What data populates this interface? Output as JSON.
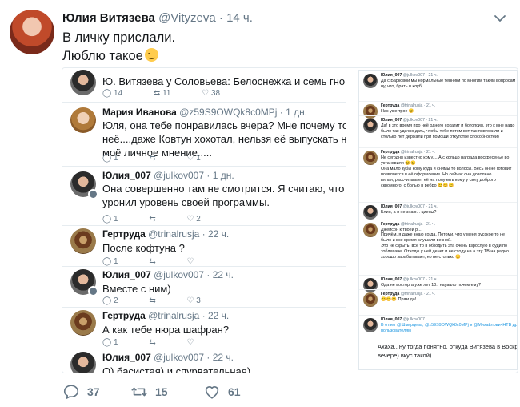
{
  "tweet": {
    "author_name": "Юлия Витязева",
    "author_handle": "@Vityzeva",
    "dot": "·",
    "time": "14 ч.",
    "lines": [
      "В личку прислали.",
      "Люблю такое"
    ],
    "emoji": "wink-smile-emoji"
  },
  "left_thread": [
    {
      "kind": "top",
      "body": "Ю. Витязева у Соловьева: Белоснежка и семь гномов)",
      "replies": "14",
      "retweets": "11",
      "likes": "38"
    },
    {
      "kind": "reply",
      "name": "Мария Иванова",
      "handle": "@z59S9OWQk8c0MPj",
      "time": "· 1 дн.",
      "lines": [
        "Юля, она тебе понравилась вчера? Мне почему то было неловко за",
        "неё....даже Ковтун хохотал, нельзя её выпускать на экран...., но это",
        "моё личное мнение....."
      ],
      "replies": "1",
      "retweets": "",
      "likes": "1"
    },
    {
      "kind": "reply",
      "name": "Юлия_007",
      "handle": "@julkov007",
      "time": "· 1 дн.",
      "lines": [
        "Она совершенно там не смотрится. Я считаю, что Соловьев",
        "уронил уровень своей программы."
      ],
      "replies": "1",
      "retweets": "",
      "likes": "2"
    },
    {
      "kind": "reply",
      "name": "Гертруда",
      "handle": "@trinalrusja",
      "time": "· 22 ч.",
      "lines": [
        "После кофтуна ?"
      ],
      "replies": "1",
      "retweets": "",
      "likes": ""
    },
    {
      "kind": "reply",
      "name": "Юлия_007",
      "handle": "@julkov007",
      "time": "· 22 ч.",
      "lines": [
        "Вместе с ним)"
      ],
      "replies": "2",
      "retweets": "",
      "likes": "3"
    },
    {
      "kind": "reply",
      "name": "Гертруда",
      "handle": "@trinalrusja",
      "time": "· 22 ч.",
      "lines": [
        "А как тебе нюра шафран?"
      ],
      "replies": "1",
      "retweets": "",
      "likes": ""
    },
    {
      "kind": "reply",
      "name": "Юлия_007",
      "handle": "@julkov007",
      "time": "· 22 ч.",
      "lines": [
        "О) басистая) и спурвательная)"
      ],
      "replies": "",
      "retweets": "",
      "likes": ""
    }
  ],
  "right_thread": {
    "rows": [
      {
        "name": "Юлия_007",
        "meta": "@julkov007 · 21 ч.",
        "lines": [
          "Да с Барковой мы нормальные тенники по многим таким вопросам",
          "ну, что, брать в клуб]"
        ]
      },
      {
        "name": "Гертруда",
        "meta": "@trinalrusja · 21 ч.",
        "lines": [
          "Нас уже трое 😊"
        ]
      },
      {
        "name": "Юлия_007",
        "meta": "@julkov007 · 21 ч.",
        "lines": [
          "Да! в это время про неё одного сокатит и ботопсия, это к мне надо",
          "было так удачно дать, чтобы тебе потом вот так повторили и",
          "столько лет держали при помощи откутстве способностей)"
        ]
      },
      {
        "name": "Гертруда",
        "meta": "@trinalrusja · 21 ч.",
        "lines": [
          "Не сегодня известно кому.... А с кольцо награда воскресенье во",
          "установили 😊😊",
          "Она мало зубы кому куда и снимы то волосы. Весь он не готовит",
          "появляется в её оформление. Но сейчас она довольно",
          "вялая, рассчитывает её на получить кому у силу доброго",
          "скромного, с болью в ребро 😊😊😊"
        ]
      },
      {
        "name": "Юлия_007",
        "meta": "@julkov007 · 21 ч.",
        "lines": [
          "Блин, а я не знаю... циены?"
        ]
      },
      {
        "name": "Гертруда",
        "meta": "@trinalrusja · 21 ч.",
        "lines": [
          "Джейсон к твоей р..."
        ]
      },
      {
        "name": "",
        "meta": "",
        "lines": [
          "Причём, я даже знаю когда. Потоми, что у меня русское то не",
          "было и все время слушали весной.",
          "Это не скрыть, все то в обходить эта очень взрослую в суди по",
          "тоблеване. Отходы у ней денег и не сходу на а эту ТВ на радио",
          "хорошо зарабатывает, но не столько 😊"
        ]
      },
      {
        "name": "Юлия_007",
        "meta": "@julkov007 · 21 ч.",
        "lines": [
          "Ода не восторга уже лет 10.. наувало почем ему?"
        ]
      },
      {
        "name": "Гертруда",
        "meta": "@trinalrusja · 21 ч.",
        "lines": [
          "😊😊😊 Прям да!"
        ]
      },
      {
        "name": "Юлия_007",
        "meta": "@julkov007",
        "lines": [
          "В ответ @Шмирцева, @z59S9OWQk8c0MPj и @МихайловичНТВ другие",
          "пользователям"
        ]
      }
    ],
    "final_lines": [
      "Ахаха.. ну тогда понятно, откуда Витязева в Воскресном",
      "вечере) вкус такой)"
    ]
  },
  "footer": {
    "replies": "37",
    "retweets": "15",
    "likes": "61"
  },
  "colors": {
    "text": "#14171a",
    "secondary": "#657786",
    "link": "#1b95e0"
  }
}
